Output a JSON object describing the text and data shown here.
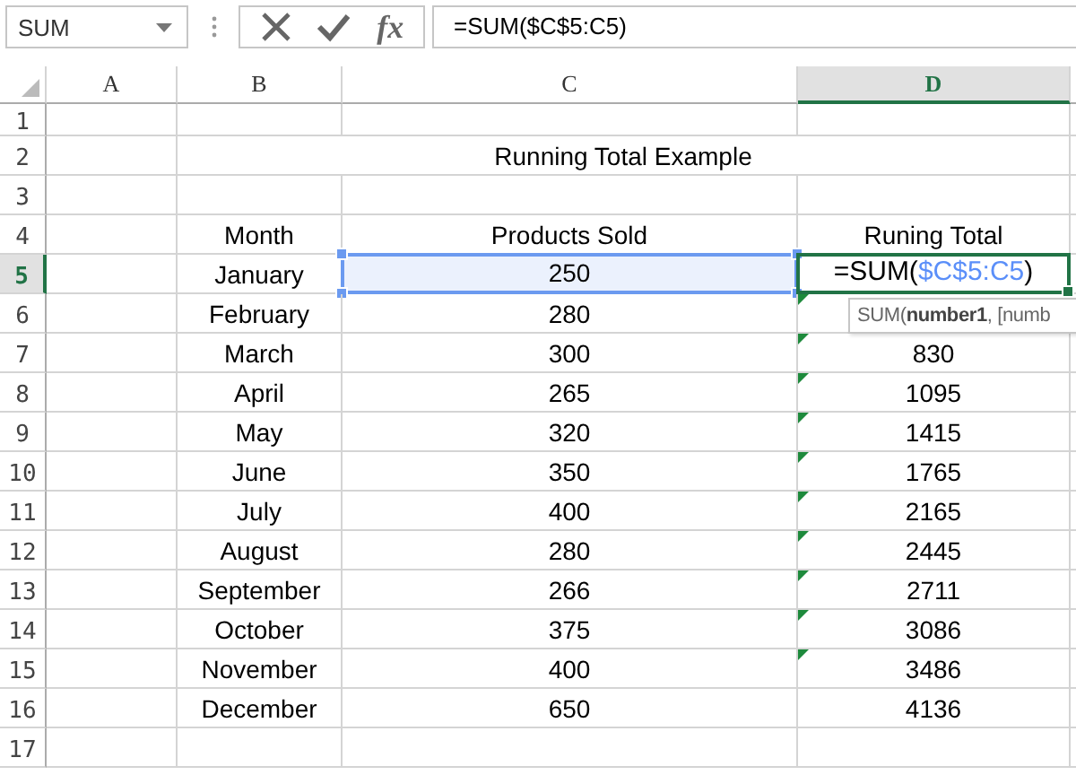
{
  "name_box": {
    "value": "SUM"
  },
  "formula_bar": {
    "function_label": "fx",
    "formula": "=SUM($C$5:C5)"
  },
  "columns": [
    {
      "label": "A",
      "selected": false
    },
    {
      "label": "B",
      "selected": false
    },
    {
      "label": "C",
      "selected": false
    },
    {
      "label": "D",
      "selected": true
    }
  ],
  "rows": [
    {
      "number": "1",
      "selected": false,
      "cells": [
        null,
        null,
        null,
        null
      ]
    },
    {
      "number": "2",
      "selected": false,
      "cells": [
        null,
        {
          "text": "Running Total Example",
          "merged": true
        },
        null,
        null
      ]
    },
    {
      "number": "3",
      "selected": false,
      "cells": [
        null,
        null,
        null,
        null
      ]
    },
    {
      "number": "4",
      "selected": false,
      "cells": [
        null,
        {
          "text": "Month"
        },
        {
          "text": "Products Sold"
        },
        {
          "text": "Runing Total"
        }
      ]
    },
    {
      "number": "5",
      "selected": true,
      "cells": [
        null,
        {
          "text": "January"
        },
        {
          "text": "250",
          "highlighted": true
        },
        {
          "kind": "editor",
          "parts": [
            {
              "text": "=SUM("
            },
            {
              "text": "$C$5:C5",
              "color": "#5b8ff9"
            },
            {
              "text": ")"
            }
          ]
        }
      ]
    },
    {
      "number": "6",
      "selected": false,
      "cells": [
        null,
        {
          "text": "February"
        },
        {
          "text": "280"
        },
        {
          "error_flag": true
        }
      ]
    },
    {
      "number": "7",
      "selected": false,
      "cells": [
        null,
        {
          "text": "March"
        },
        {
          "text": "300"
        },
        {
          "text": "830",
          "error_flag": true
        }
      ]
    },
    {
      "number": "8",
      "selected": false,
      "cells": [
        null,
        {
          "text": "April"
        },
        {
          "text": "265"
        },
        {
          "text": "1095",
          "error_flag": true
        }
      ]
    },
    {
      "number": "9",
      "selected": false,
      "cells": [
        null,
        {
          "text": "May"
        },
        {
          "text": "320"
        },
        {
          "text": "1415",
          "error_flag": true
        }
      ]
    },
    {
      "number": "10",
      "selected": false,
      "cells": [
        null,
        {
          "text": "June"
        },
        {
          "text": "350"
        },
        {
          "text": "1765",
          "error_flag": true
        }
      ]
    },
    {
      "number": "11",
      "selected": false,
      "cells": [
        null,
        {
          "text": "July"
        },
        {
          "text": "400"
        },
        {
          "text": "2165",
          "error_flag": true
        }
      ]
    },
    {
      "number": "12",
      "selected": false,
      "cells": [
        null,
        {
          "text": "August"
        },
        {
          "text": "280"
        },
        {
          "text": "2445",
          "error_flag": true
        }
      ]
    },
    {
      "number": "13",
      "selected": false,
      "cells": [
        null,
        {
          "text": "September"
        },
        {
          "text": "266"
        },
        {
          "text": "2711",
          "error_flag": true
        }
      ]
    },
    {
      "number": "14",
      "selected": false,
      "cells": [
        null,
        {
          "text": "October"
        },
        {
          "text": "375"
        },
        {
          "text": "3086",
          "error_flag": true
        }
      ]
    },
    {
      "number": "15",
      "selected": false,
      "cells": [
        null,
        {
          "text": "November"
        },
        {
          "text": "400"
        },
        {
          "text": "3486",
          "error_flag": true
        }
      ]
    },
    {
      "number": "16",
      "selected": false,
      "cells": [
        null,
        {
          "text": "December"
        },
        {
          "text": "650"
        },
        {
          "text": "4136"
        }
      ]
    },
    {
      "number": "17",
      "selected": false,
      "cells": [
        null,
        null,
        null,
        null
      ]
    }
  ],
  "tooltip": {
    "text": "SUM(**number1**, [numb"
  }
}
